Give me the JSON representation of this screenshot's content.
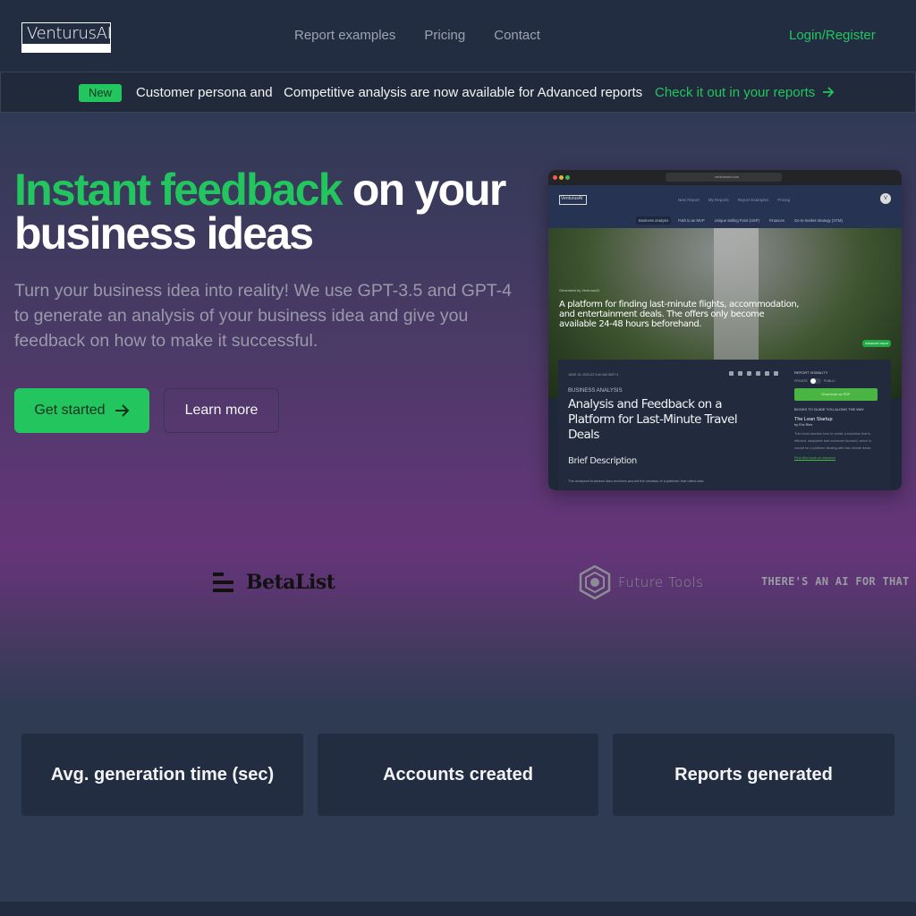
{
  "header": {
    "logo": "VenturusAI",
    "nav": [
      "Report examples",
      "Pricing",
      "Contact"
    ],
    "login": "Login/Register"
  },
  "banner": {
    "badge": "New",
    "text": "Customer persona and   Competitive analysis are now available for Advanced reports",
    "link": "Check it out in your reports",
    "link_icon": "arrow-right-icon"
  },
  "hero": {
    "title_highlight": "Instant feedback",
    "title_rest_line1": " on your",
    "title_line2": "business ideas",
    "subtitle": "Turn your business idea into reality! We use GPT-3.5 and GPT-4 to generate an analysis of your business idea and give you feedback on how to make it successful.",
    "primary_button": "Get started",
    "secondary_button": "Learn more"
  },
  "preview": {
    "url": "venturusai.com",
    "logo": "VenturusAI",
    "nav": [
      "New Report",
      "My Reports",
      "Report Examples",
      "Pricing"
    ],
    "avatar": "V",
    "tabs": [
      "Business analysis",
      "Path to an MVP",
      "Unique Selling Point (USP)",
      "Finances",
      "Go-to-market strategy (GTM)"
    ],
    "generated_by": "Generated by VenturusAI",
    "headline": "A platform for finding last-minute flights, accommodation, and entertainment deals. The offers only become available 24-48 hours beforehand.",
    "advanced_badge": "Advanced report",
    "date": "JUNE 19, 2023 AT 9:40 AM GMT+1",
    "category": "BUSINESS ANALYSIS",
    "title": "Analysis and Feedback on a Platform for Last-Minute Travel Deals",
    "section": "Brief Description",
    "description": "The analyzed business idea revolves around the creation of a platform that offers last-",
    "visibility_label": "REPORT VISIBILITY",
    "private_label": "PRIVATE",
    "public_label": "PUBLIC",
    "download": "Download as PDF",
    "books_label": "BOOKS TO GUIDE YOU ALONG THE WAY",
    "book_title": "The Lean Startup",
    "book_author": "by Eric Ries",
    "book_desc": "This book teaches how to create a business that is efficient, adaptable and customer-focused, which is crucial for a platform dealing with last-minute deals.",
    "book_link": "Find this book on Amazon"
  },
  "logos": {
    "betalist": "BetaList",
    "futuretools": "Future Tools",
    "aiforthat": "THERE'S AN AI FOR THAT"
  },
  "stats": [
    {
      "label": "Avg. generation time (sec)"
    },
    {
      "label": "Accounts created"
    },
    {
      "label": "Reports generated"
    }
  ],
  "colors": {
    "accent": "#22c55e",
    "header_bg": "#232d42",
    "banner_bg": "#212a3b",
    "card_bg": "#232d42"
  }
}
